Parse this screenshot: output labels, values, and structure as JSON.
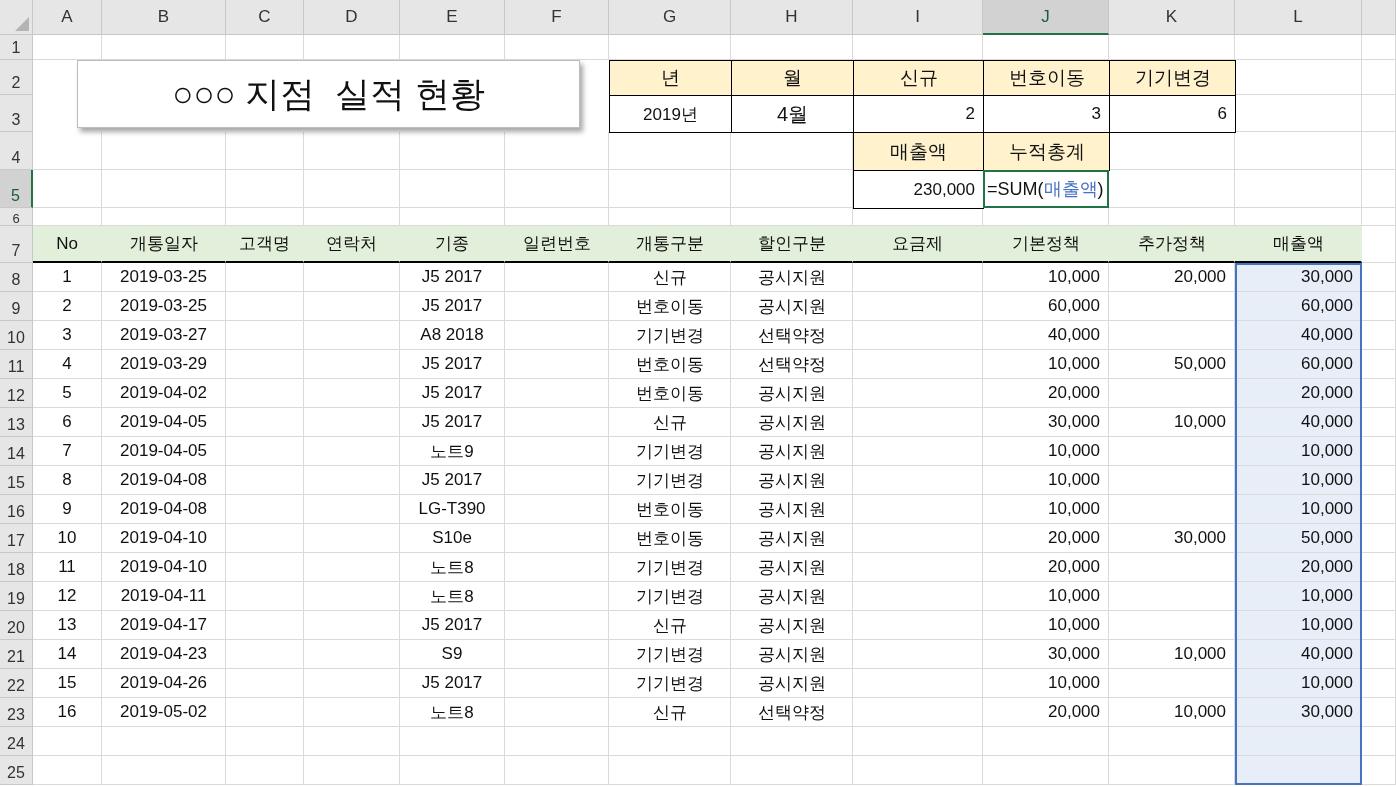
{
  "column_headers": [
    {
      "label": "A",
      "selected": false
    },
    {
      "label": "B",
      "selected": false
    },
    {
      "label": "C",
      "selected": false
    },
    {
      "label": "D",
      "selected": false
    },
    {
      "label": "E",
      "selected": false
    },
    {
      "label": "F",
      "selected": false
    },
    {
      "label": "G",
      "selected": false
    },
    {
      "label": "H",
      "selected": false
    },
    {
      "label": "I",
      "selected": false
    },
    {
      "label": "J",
      "selected": true
    },
    {
      "label": "K",
      "selected": false
    },
    {
      "label": "L",
      "selected": false
    }
  ],
  "row_headers": [
    {
      "label": "1",
      "selected": false
    },
    {
      "label": "2",
      "selected": false
    },
    {
      "label": "3",
      "selected": false
    },
    {
      "label": "4",
      "selected": false
    },
    {
      "label": "5",
      "selected": true
    },
    {
      "label": "6",
      "selected": false
    },
    {
      "label": "7",
      "selected": false
    },
    {
      "label": "8",
      "selected": false
    },
    {
      "label": "9",
      "selected": false
    },
    {
      "label": "10",
      "selected": false
    },
    {
      "label": "11",
      "selected": false
    },
    {
      "label": "12",
      "selected": false
    },
    {
      "label": "13",
      "selected": false
    },
    {
      "label": "14",
      "selected": false
    },
    {
      "label": "15",
      "selected": false
    },
    {
      "label": "16",
      "selected": false
    },
    {
      "label": "17",
      "selected": false
    },
    {
      "label": "18",
      "selected": false
    },
    {
      "label": "19",
      "selected": false
    },
    {
      "label": "20",
      "selected": false
    },
    {
      "label": "21",
      "selected": false
    },
    {
      "label": "22",
      "selected": false
    },
    {
      "label": "23",
      "selected": false
    },
    {
      "label": "24",
      "selected": false
    },
    {
      "label": "25",
      "selected": false
    }
  ],
  "title": "○○○ 지점  실적 현황",
  "summary": {
    "items": [
      {
        "header": "년",
        "value": "2019년",
        "kind": "text"
      },
      {
        "header": "월",
        "value": "4월",
        "kind": "text"
      },
      {
        "header": "신규",
        "value": "2",
        "kind": "number"
      },
      {
        "header": "번호이동",
        "value": "3",
        "kind": "number"
      },
      {
        "header": "기기변경",
        "value": "6",
        "kind": "number"
      }
    ],
    "sales_header": "매출액",
    "total_header": "누적총계",
    "sales_total": "230,000",
    "formula": [
      {
        "text": "=SUM(",
        "kind": "plain"
      },
      {
        "text": "매출액",
        "kind": "reference"
      },
      {
        "text": ")",
        "kind": "plain"
      }
    ]
  },
  "table": {
    "columns": [
      {
        "label": "No",
        "kind": "text",
        "referenced": false
      },
      {
        "label": "개통일자",
        "kind": "text",
        "referenced": false
      },
      {
        "label": "고객명",
        "referenced": false
      },
      {
        "label": "연락처",
        "referenced": false
      },
      {
        "label": "기종",
        "kind": "text",
        "referenced": false
      },
      {
        "label": "일련번호",
        "referenced": false
      },
      {
        "label": "개통구분",
        "kind": "text",
        "referenced": false
      },
      {
        "label": "할인구분",
        "kind": "text",
        "referenced": false
      },
      {
        "label": "요금제",
        "referenced": false
      },
      {
        "label": "기본정책",
        "kind": "number",
        "referenced": false
      },
      {
        "label": "추가정책",
        "kind": "number",
        "referenced": false
      },
      {
        "label": "매출액",
        "kind": "number",
        "referenced": true
      }
    ],
    "rows": [
      [
        "1",
        "2019-03-25",
        null,
        null,
        "J5 2017",
        null,
        "신규",
        "공시지원",
        null,
        "10,000",
        "20,000",
        "30,000"
      ],
      [
        "2",
        "2019-03-25",
        null,
        null,
        "J5 2017",
        null,
        "번호이동",
        "공시지원",
        null,
        "60,000",
        null,
        "60,000"
      ],
      [
        "3",
        "2019-03-27",
        null,
        null,
        "A8 2018",
        null,
        "기기변경",
        "선택약정",
        null,
        "40,000",
        null,
        "40,000"
      ],
      [
        "4",
        "2019-03-29",
        null,
        null,
        "J5 2017",
        null,
        "번호이동",
        "선택약정",
        null,
        "10,000",
        "50,000",
        "60,000"
      ],
      [
        "5",
        "2019-04-02",
        null,
        null,
        "J5 2017",
        null,
        "번호이동",
        "공시지원",
        null,
        "20,000",
        null,
        "20,000"
      ],
      [
        "6",
        "2019-04-05",
        null,
        null,
        "J5 2017",
        null,
        "신규",
        "공시지원",
        null,
        "30,000",
        "10,000",
        "40,000"
      ],
      [
        "7",
        "2019-04-05",
        null,
        null,
        "노트9",
        null,
        "기기변경",
        "공시지원",
        null,
        "10,000",
        null,
        "10,000"
      ],
      [
        "8",
        "2019-04-08",
        null,
        null,
        "J5 2017",
        null,
        "기기변경",
        "공시지원",
        null,
        "10,000",
        null,
        "10,000"
      ],
      [
        "9",
        "2019-04-08",
        null,
        null,
        "LG-T390",
        null,
        "번호이동",
        "공시지원",
        null,
        "10,000",
        null,
        "10,000"
      ],
      [
        "10",
        "2019-04-10",
        null,
        null,
        "S10e",
        null,
        "번호이동",
        "공시지원",
        null,
        "20,000",
        "30,000",
        "50,000"
      ],
      [
        "11",
        "2019-04-10",
        null,
        null,
        "노트8",
        null,
        "기기변경",
        "공시지원",
        null,
        "20,000",
        null,
        "20,000"
      ],
      [
        "12",
        "2019-04-11",
        null,
        null,
        "노트8",
        null,
        "기기변경",
        "공시지원",
        null,
        "10,000",
        null,
        "10,000"
      ],
      [
        "13",
        "2019-04-17",
        null,
        null,
        "J5 2017",
        null,
        "신규",
        "공시지원",
        null,
        "10,000",
        null,
        "10,000"
      ],
      [
        "14",
        "2019-04-23",
        null,
        null,
        "S9",
        null,
        "기기변경",
        "공시지원",
        null,
        "30,000",
        "10,000",
        "40,000"
      ],
      [
        "15",
        "2019-04-26",
        null,
        null,
        "J5 2017",
        null,
        "기기변경",
        "공시지원",
        null,
        "10,000",
        null,
        "10,000"
      ],
      [
        "16",
        "2019-05-02",
        null,
        null,
        "노트8",
        null,
        "신규",
        "선택약정",
        null,
        "20,000",
        "10,000",
        "30,000"
      ]
    ]
  }
}
